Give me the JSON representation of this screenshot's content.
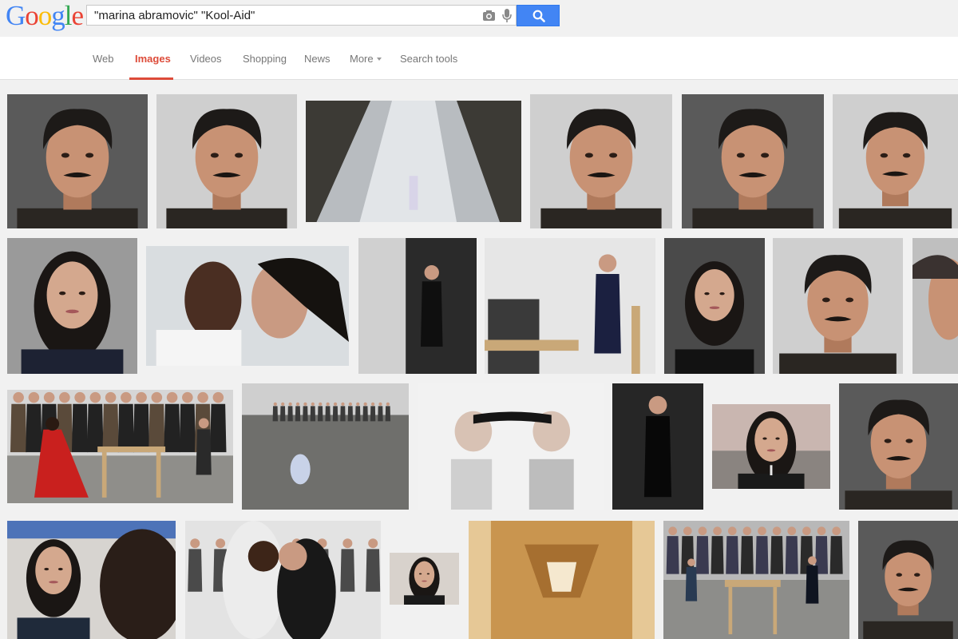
{
  "logo": {
    "letters": [
      "G",
      "o",
      "o",
      "g",
      "l",
      "e"
    ],
    "colors": [
      "#4285f4",
      "#ea4335",
      "#fbbc05",
      "#4285f4",
      "#34a853",
      "#ea4335"
    ]
  },
  "search": {
    "query": "\"marina abramovic\" \"Kool-Aid\"",
    "camera_icon": "camera-icon",
    "mic_icon": "microphone-icon",
    "button_icon": "magnifier-icon"
  },
  "tabs": [
    {
      "label": "Web"
    },
    {
      "label": "Images",
      "active": true
    },
    {
      "label": "Videos"
    },
    {
      "label": "Shopping"
    },
    {
      "label": "News"
    },
    {
      "label": "More"
    },
    {
      "label": "Search tools"
    }
  ],
  "colors": {
    "accent": "#dd4b39",
    "search_button": "#4285f4",
    "page_bg": "#f1f1f1"
  },
  "results": [
    {
      "subject": "man-portrait-mustache"
    },
    {
      "subject": "man-portrait-mustache"
    },
    {
      "subject": "waterfall"
    },
    {
      "subject": "man-portrait-mustache"
    },
    {
      "subject": "man-portrait-mustache"
    },
    {
      "subject": "man-portrait-mustache"
    },
    {
      "subject": "woman-portrait"
    },
    {
      "subject": "two-people-foreheads"
    },
    {
      "subject": "woman-black-dress-bw"
    },
    {
      "subject": "woman-seated-table"
    },
    {
      "subject": "woman-red-lips"
    },
    {
      "subject": "man-portrait-mustache"
    },
    {
      "subject": "man-portrait-partial"
    },
    {
      "subject": "red-dress-seated-performance"
    },
    {
      "subject": "gallery-floor"
    },
    {
      "subject": "two-profiles-hair-tied"
    },
    {
      "subject": "woman-black-gown"
    },
    {
      "subject": "woman-cross-necklace"
    },
    {
      "subject": "man-portrait-mustache"
    },
    {
      "subject": "woman-crowd"
    },
    {
      "subject": "embrace-crowd"
    },
    {
      "subject": "woman-small-portrait"
    },
    {
      "subject": "wooden-interior"
    },
    {
      "subject": "seated-performance-crowd"
    },
    {
      "subject": "man-portrait-mustache"
    }
  ]
}
